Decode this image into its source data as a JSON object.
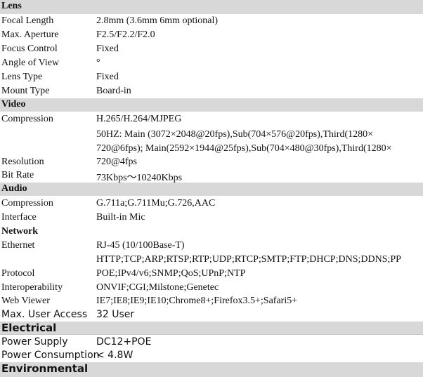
{
  "sections": {
    "lens": {
      "title": "Lens",
      "rows": [
        {
          "label": "Focal Length",
          "value": "2.8mm (3.6mm 6mm optional)"
        },
        {
          "label": "Max. Aperture",
          "value": "F2.5/F2.2/F2.0"
        },
        {
          "label": "Focus Control",
          "value": "Fixed"
        },
        {
          "label": "Angle of View",
          "value": "°"
        },
        {
          "label": "Lens Type",
          "value": "Fixed"
        },
        {
          "label": "Mount Type",
          "value": "Board-in"
        }
      ]
    },
    "video": {
      "title": "Video",
      "rows": [
        {
          "label": "Compression",
          "value": "H.265/H.264/MJPEG"
        },
        {
          "label": "Resolution",
          "value": "50HZ: Main  (3072×2048@20fps),Sub(704×576@20fps),Third(1280×720@6fps); Main(2592×1944@25fps),Sub(704×480@30fps),Third(1280×720@4fps"
        },
        {
          "label": "Bit Rate",
          "value": "73Kbps〜10240Kbps"
        }
      ]
    },
    "audio": {
      "title": "Audio",
      "rows": [
        {
          "label": "Compression",
          "value": "G.711a;G.711Mu;G.726,AAC"
        },
        {
          "label": "Interface",
          "value": "Built-in Mic"
        }
      ]
    },
    "network": {
      "title": "Network",
      "rows": [
        {
          "label": "Ethernet",
          "value": "RJ-45 (10/100Base-T)"
        },
        {
          "label": "Protocol",
          "value": "HTTP;TCP;ARP;RTSP;RTP;UDP;RTCP;SMTP;FTP;DHCP;DNS;DDNS;PPPOE;IPv4/v6;SNMP;QoS;UPnP;NTP"
        },
        {
          "label": "Interoperability",
          "value": "ONVIF;CGI;Milstone;Genetec"
        },
        {
          "label": "Web Viewer",
          "value": "IE7;IE8;IE9;IE10;Chrome8+;Firefox3.5+;Safari5+"
        },
        {
          "label": "Max. User Access",
          "value": "32 User"
        }
      ]
    },
    "electrical": {
      "title": "Electrical",
      "rows": [
        {
          "label": "Power Supply",
          "value": "DC12+POE"
        },
        {
          "label": "Power Consumption",
          "value": "< 4.8W"
        }
      ]
    },
    "environmental": {
      "title": "Environmental"
    }
  },
  "wrapped_lines": {
    "resolution_line1": "50HZ: Main  (3072×2048@20fps),Sub(704×576@20fps),Third(1280×",
    "resolution_line2": "720@6fps); Main(2592×1944@25fps),Sub(704×480@30fps),Third(1280×",
    "resolution_line3": "720@4fps",
    "protocol_line1": "HTTP;TCP;ARP;RTSP;RTP;UDP;RTCP;SMTP;FTP;DHCP;DNS;DDNS;PP",
    "protocol_line2": "POE;IPv4/v6;SNMP;QoS;UPnP;NTP"
  }
}
